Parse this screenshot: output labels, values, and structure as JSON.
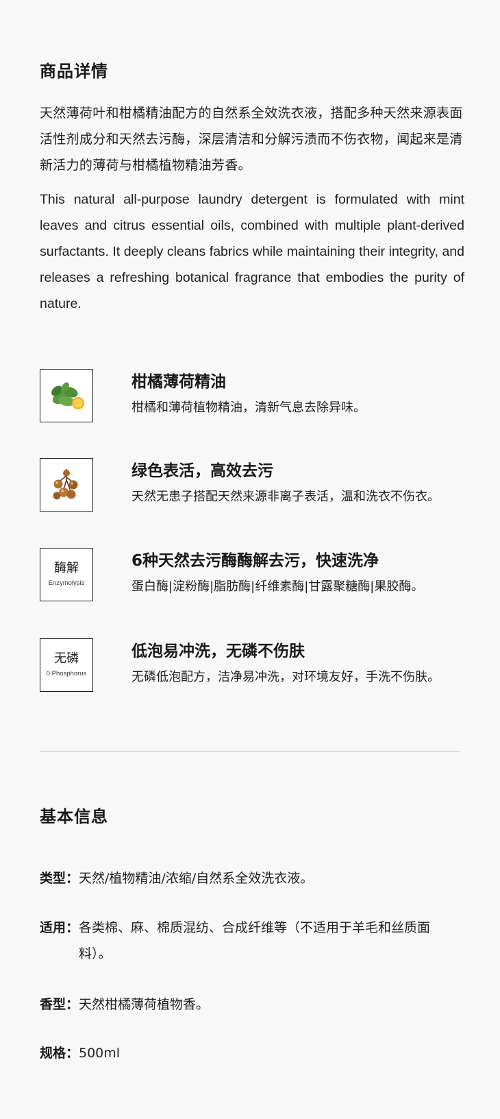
{
  "detail": {
    "title": "商品详情",
    "desc_cn": "天然薄荷叶和柑橘精油配方的自然系全效洗衣液，搭配多种天然来源表面活性剂成分和天然去污酶，深层清洁和分解污渍而不伤衣物，闻起来是清新活力的薄荷与柑橘植物精油芳香。",
    "desc_en": "This natural all-purpose laundry detergent is formulated with mint leaves and citrus essential oils, combined with multiple plant-derived surfactants. It deeply cleans fabrics while maintaining their integrity, and releases a refreshing botanical fragrance that embodies the purity of nature."
  },
  "features": [
    {
      "icon": "mint-citrus-icon",
      "title": "柑橘薄荷精油",
      "desc": "柑橘和薄荷植物精油，清新气息去除异味。"
    },
    {
      "icon": "soapberry-icon",
      "title": "绿色表活，高效去污",
      "desc": "天然无患子搭配天然来源非离子表活，温和洗衣不伤衣。"
    },
    {
      "icon_text_cn": "酶解",
      "icon_text_en": "Enzymolysis",
      "title": "6种天然去污酶酶解去污，快速洗净",
      "desc": "蛋白酶|淀粉酶|脂肪酶|纤维素酶|甘露聚糖酶|果胶酶。"
    },
    {
      "icon_text_cn": "无磷",
      "icon_text_en": "0 Phosphorus",
      "title": "低泡易冲洗，无磷不伤肤",
      "desc": "无磷低泡配方，洁净易冲洗，对环境友好，手洗不伤肤。"
    }
  ],
  "basic": {
    "title": "基本信息",
    "rows": [
      {
        "label": "类型：",
        "value": "天然/植物精油/浓缩/自然系全效洗衣液。"
      },
      {
        "label": "适用：",
        "value": "各类棉、麻、棉质混纺、合成纤维等（不适用于羊毛和丝质面料）。"
      },
      {
        "label": "香型：",
        "value": "天然柑橘薄荷植物香。"
      },
      {
        "label": "规格：",
        "value": "500ml"
      }
    ]
  },
  "colors": {
    "background": "#f8f8f8",
    "text": "#1a1a1a",
    "divider": "#bdbdbd",
    "leaf": "#4f8f3a",
    "citrus": "#f2b51d",
    "berry": "#a8662b"
  }
}
